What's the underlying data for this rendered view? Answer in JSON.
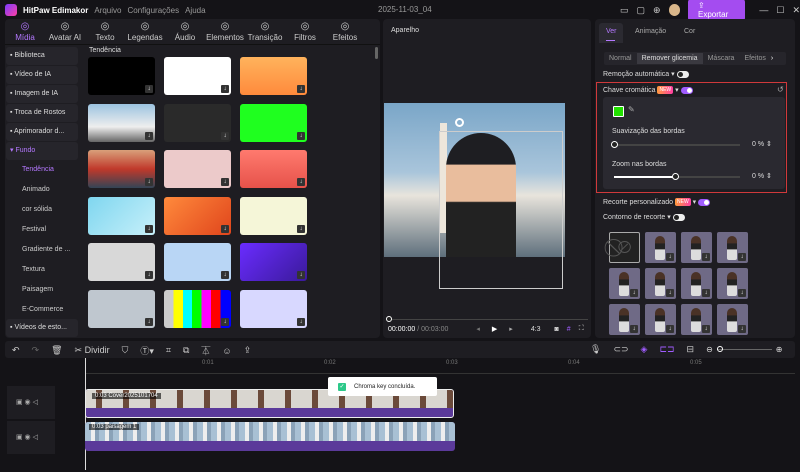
{
  "app": {
    "title": "HitPaw Edimakor",
    "menu": [
      "Arquivo",
      "Configurações",
      "Ajuda"
    ],
    "project": "2025-11-03_04",
    "export": "Exportar"
  },
  "tools": [
    {
      "label": "Mídia",
      "icon": "media-icon"
    },
    {
      "label": "Avatar AI",
      "icon": "avatar-icon"
    },
    {
      "label": "Texto",
      "icon": "text-icon"
    },
    {
      "label": "Legendas",
      "icon": "captions-icon"
    },
    {
      "label": "Áudio",
      "icon": "audio-icon"
    },
    {
      "label": "Elementos",
      "icon": "elements-icon"
    },
    {
      "label": "Transição",
      "icon": "transition-icon"
    },
    {
      "label": "Filtros",
      "icon": "filters-icon"
    },
    {
      "label": "Efeitos",
      "icon": "effects-icon"
    }
  ],
  "sidebar": {
    "items": [
      "Biblioteca",
      "Vídeo de IA",
      "Imagem de IA",
      "Troca de Rostos",
      "Aprimorador d...",
      "Fundo"
    ],
    "sub": [
      "Tendência",
      "Animado",
      "cor sólida",
      "Festival",
      "Gradiente de ...",
      "Textura",
      "Paisagem",
      "E-Commerce"
    ],
    "last": "Vídeos de esto..."
  },
  "grid": {
    "title": "Tendência"
  },
  "preview": {
    "title": "Aparelho",
    "time_current": "00:00:00",
    "time_total": "/ 00:03:00",
    "ratio": "4:3"
  },
  "right": {
    "tabs": [
      "Ver",
      "Animação",
      "Cor"
    ],
    "subtabs": [
      "Normal",
      "Remover glicemia",
      "Máscara",
      "Efeitos"
    ],
    "auto_remove": "Remoção automática",
    "chroma": "Chave cromática",
    "new": "NEW",
    "key_color": "#22e000",
    "smooth": "Suavização das bordas",
    "smooth_val": "0",
    "zoom": "Zoom nas bordas",
    "zoom_val": "0",
    "pct": "%",
    "custom_cut": "Recorte personalizado",
    "outline": "Contorno de recorte"
  },
  "timeline": {
    "split": "Dividir",
    "ticks": [
      "0:01",
      "0:02",
      "0:03",
      "0:04",
      "0:05"
    ],
    "clip1": "0:03 Cover2025101704",
    "clip2": "0:03 paisagem 1",
    "toast": "Chroma key concluída."
  },
  "colors": {
    "accent": "#a05cff",
    "highlight": "#d0393b"
  }
}
